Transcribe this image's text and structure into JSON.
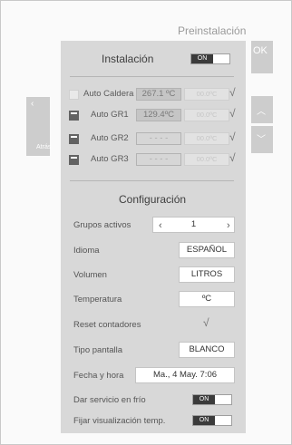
{
  "page_title": "Preinstalación",
  "ok_label": "OK",
  "back_label": "Atrás",
  "installation": {
    "title": "Instalación",
    "toggle_label": "ON",
    "rows": [
      {
        "label": "Auto Caldera",
        "value": "267.1 ºC",
        "setpoint": "00.0ºC",
        "checked": false,
        "faded": false
      },
      {
        "label": "Auto GR1",
        "value": "129.4ºC",
        "setpoint": "00.0ºC",
        "checked": true,
        "faded": false
      },
      {
        "label": "Auto GR2",
        "value": "- - - -",
        "setpoint": "00.0ºC",
        "checked": true,
        "faded": true
      },
      {
        "label": "Auto GR3",
        "value": "- - - -",
        "setpoint": "00.0ºC",
        "checked": true,
        "faded": true
      }
    ],
    "tick": "√"
  },
  "configuration": {
    "title": "Configuración",
    "active_groups": {
      "label": "Grupos activos",
      "value": "1",
      "prev": "‹",
      "next": "›"
    },
    "language": {
      "label": "Idioma",
      "value": "ESPAÑOL"
    },
    "volume": {
      "label": "Volumen",
      "value": "LITROS"
    },
    "temperature": {
      "label": "Temperatura",
      "value": "ºC"
    },
    "reset_counters": {
      "label": "Reset contadores",
      "value": "√"
    },
    "screen_type": {
      "label": "Tipo pantalla",
      "value": "BLANCO"
    },
    "date_time": {
      "label": "Fecha y hora",
      "value": "Ma., 4 May. 7:06"
    },
    "cold_service": {
      "label": "Dar servicio en frío",
      "toggle": "ON"
    },
    "fix_temp_display": {
      "label": "Fijar visualización temp.",
      "toggle": "ON"
    }
  }
}
